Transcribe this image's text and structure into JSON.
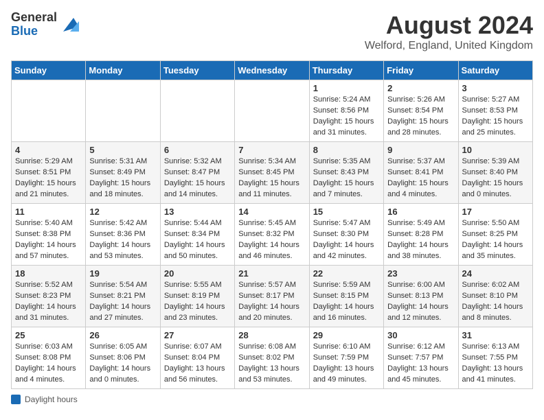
{
  "logo": {
    "general": "General",
    "blue": "Blue"
  },
  "title": "August 2024",
  "location": "Welford, England, United Kingdom",
  "days_of_week": [
    "Sunday",
    "Monday",
    "Tuesday",
    "Wednesday",
    "Thursday",
    "Friday",
    "Saturday"
  ],
  "weeks": [
    [
      {
        "day": "",
        "info": ""
      },
      {
        "day": "",
        "info": ""
      },
      {
        "day": "",
        "info": ""
      },
      {
        "day": "",
        "info": ""
      },
      {
        "day": "1",
        "info": "Sunrise: 5:24 AM\nSunset: 8:56 PM\nDaylight: 15 hours\nand 31 minutes."
      },
      {
        "day": "2",
        "info": "Sunrise: 5:26 AM\nSunset: 8:54 PM\nDaylight: 15 hours\nand 28 minutes."
      },
      {
        "day": "3",
        "info": "Sunrise: 5:27 AM\nSunset: 8:53 PM\nDaylight: 15 hours\nand 25 minutes."
      }
    ],
    [
      {
        "day": "4",
        "info": "Sunrise: 5:29 AM\nSunset: 8:51 PM\nDaylight: 15 hours\nand 21 minutes."
      },
      {
        "day": "5",
        "info": "Sunrise: 5:31 AM\nSunset: 8:49 PM\nDaylight: 15 hours\nand 18 minutes."
      },
      {
        "day": "6",
        "info": "Sunrise: 5:32 AM\nSunset: 8:47 PM\nDaylight: 15 hours\nand 14 minutes."
      },
      {
        "day": "7",
        "info": "Sunrise: 5:34 AM\nSunset: 8:45 PM\nDaylight: 15 hours\nand 11 minutes."
      },
      {
        "day": "8",
        "info": "Sunrise: 5:35 AM\nSunset: 8:43 PM\nDaylight: 15 hours\nand 7 minutes."
      },
      {
        "day": "9",
        "info": "Sunrise: 5:37 AM\nSunset: 8:41 PM\nDaylight: 15 hours\nand 4 minutes."
      },
      {
        "day": "10",
        "info": "Sunrise: 5:39 AM\nSunset: 8:40 PM\nDaylight: 15 hours\nand 0 minutes."
      }
    ],
    [
      {
        "day": "11",
        "info": "Sunrise: 5:40 AM\nSunset: 8:38 PM\nDaylight: 14 hours\nand 57 minutes."
      },
      {
        "day": "12",
        "info": "Sunrise: 5:42 AM\nSunset: 8:36 PM\nDaylight: 14 hours\nand 53 minutes."
      },
      {
        "day": "13",
        "info": "Sunrise: 5:44 AM\nSunset: 8:34 PM\nDaylight: 14 hours\nand 50 minutes."
      },
      {
        "day": "14",
        "info": "Sunrise: 5:45 AM\nSunset: 8:32 PM\nDaylight: 14 hours\nand 46 minutes."
      },
      {
        "day": "15",
        "info": "Sunrise: 5:47 AM\nSunset: 8:30 PM\nDaylight: 14 hours\nand 42 minutes."
      },
      {
        "day": "16",
        "info": "Sunrise: 5:49 AM\nSunset: 8:28 PM\nDaylight: 14 hours\nand 38 minutes."
      },
      {
        "day": "17",
        "info": "Sunrise: 5:50 AM\nSunset: 8:25 PM\nDaylight: 14 hours\nand 35 minutes."
      }
    ],
    [
      {
        "day": "18",
        "info": "Sunrise: 5:52 AM\nSunset: 8:23 PM\nDaylight: 14 hours\nand 31 minutes."
      },
      {
        "day": "19",
        "info": "Sunrise: 5:54 AM\nSunset: 8:21 PM\nDaylight: 14 hours\nand 27 minutes."
      },
      {
        "day": "20",
        "info": "Sunrise: 5:55 AM\nSunset: 8:19 PM\nDaylight: 14 hours\nand 23 minutes."
      },
      {
        "day": "21",
        "info": "Sunrise: 5:57 AM\nSunset: 8:17 PM\nDaylight: 14 hours\nand 20 minutes."
      },
      {
        "day": "22",
        "info": "Sunrise: 5:59 AM\nSunset: 8:15 PM\nDaylight: 14 hours\nand 16 minutes."
      },
      {
        "day": "23",
        "info": "Sunrise: 6:00 AM\nSunset: 8:13 PM\nDaylight: 14 hours\nand 12 minutes."
      },
      {
        "day": "24",
        "info": "Sunrise: 6:02 AM\nSunset: 8:10 PM\nDaylight: 14 hours\nand 8 minutes."
      }
    ],
    [
      {
        "day": "25",
        "info": "Sunrise: 6:03 AM\nSunset: 8:08 PM\nDaylight: 14 hours\nand 4 minutes."
      },
      {
        "day": "26",
        "info": "Sunrise: 6:05 AM\nSunset: 8:06 PM\nDaylight: 14 hours\nand 0 minutes."
      },
      {
        "day": "27",
        "info": "Sunrise: 6:07 AM\nSunset: 8:04 PM\nDaylight: 13 hours\nand 56 minutes."
      },
      {
        "day": "28",
        "info": "Sunrise: 6:08 AM\nSunset: 8:02 PM\nDaylight: 13 hours\nand 53 minutes."
      },
      {
        "day": "29",
        "info": "Sunrise: 6:10 AM\nSunset: 7:59 PM\nDaylight: 13 hours\nand 49 minutes."
      },
      {
        "day": "30",
        "info": "Sunrise: 6:12 AM\nSunset: 7:57 PM\nDaylight: 13 hours\nand 45 minutes."
      },
      {
        "day": "31",
        "info": "Sunrise: 6:13 AM\nSunset: 7:55 PM\nDaylight: 13 hours\nand 41 minutes."
      }
    ]
  ],
  "legend": {
    "daylight_label": "Daylight hours"
  }
}
